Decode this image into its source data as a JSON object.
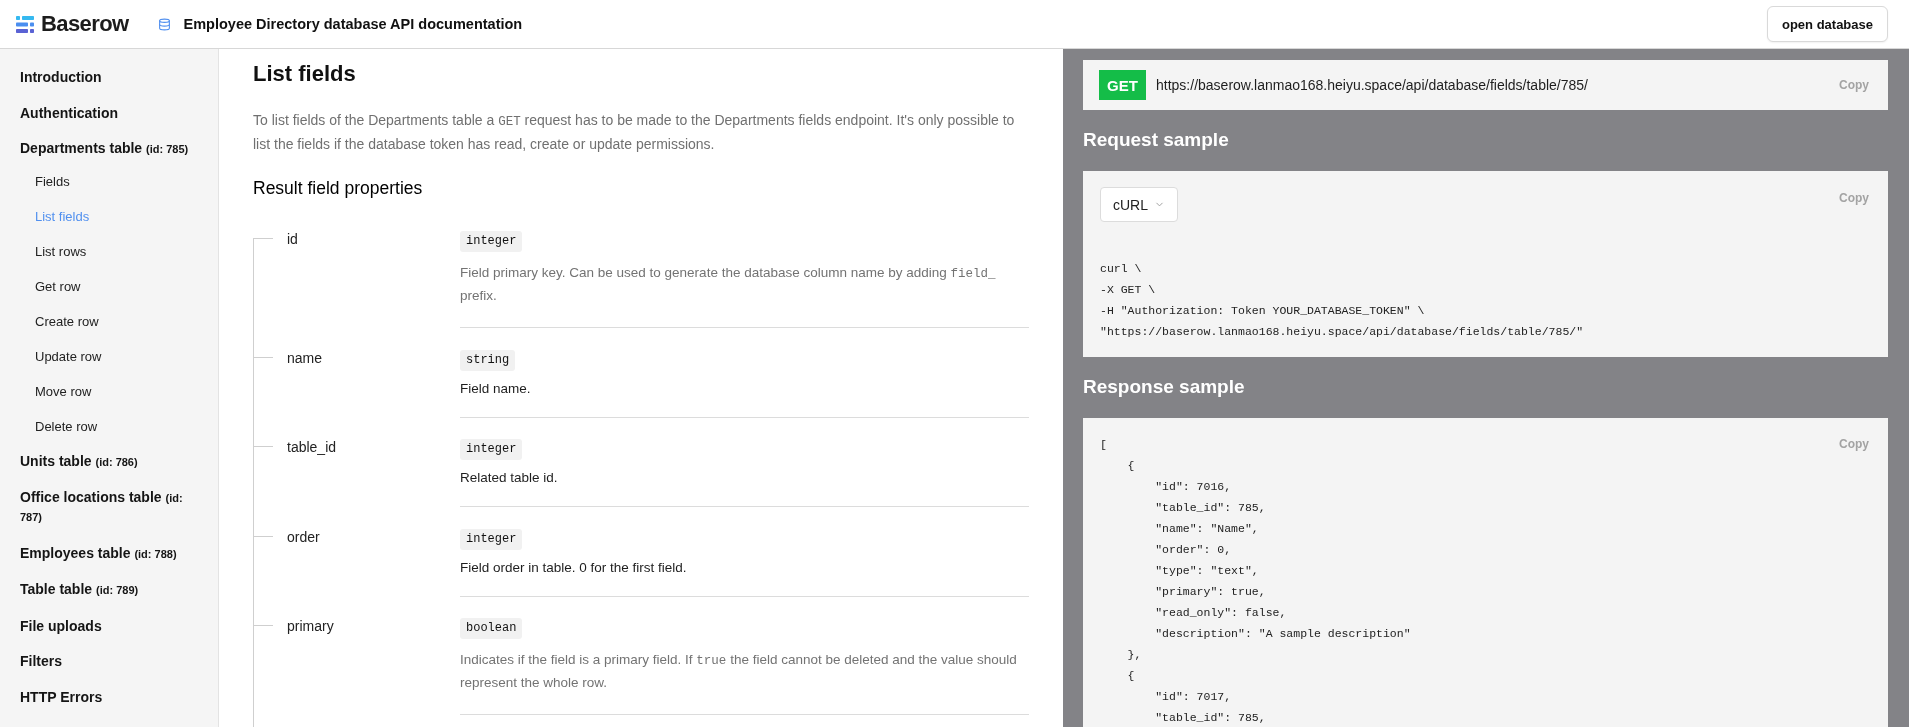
{
  "header": {
    "logo": "Baserow",
    "title": "Employee Directory database API documentation",
    "open_button": "open database"
  },
  "sidebar": {
    "items": [
      {
        "label": "Introduction",
        "selected": false
      },
      {
        "label": "Authentication",
        "selected": false
      },
      {
        "label": "Departments table",
        "note": "(id: 785)",
        "selected": false,
        "children": [
          {
            "label": "Fields",
            "selected": false
          },
          {
            "label": "List fields",
            "selected": true
          },
          {
            "label": "List rows",
            "selected": false
          },
          {
            "label": "Get row",
            "selected": false
          },
          {
            "label": "Create row",
            "selected": false
          },
          {
            "label": "Update row",
            "selected": false
          },
          {
            "label": "Move row",
            "selected": false
          },
          {
            "label": "Delete row",
            "selected": false
          }
        ]
      },
      {
        "label": "Units table",
        "note": "(id: 786)",
        "selected": false
      },
      {
        "label": "Office locations table",
        "note": "(id: 787)",
        "selected": false
      },
      {
        "label": "Employees table",
        "note": "(id: 788)",
        "selected": false
      },
      {
        "label": "Table table",
        "note": "(id: 789)",
        "selected": false
      },
      {
        "label": "File uploads",
        "selected": false
      },
      {
        "label": "Filters",
        "selected": false
      },
      {
        "label": "HTTP Errors",
        "selected": false
      }
    ]
  },
  "content": {
    "title": "List fields",
    "description": [
      {
        "text": "To list fields of the Departments table a ",
        "code": false
      },
      {
        "text": "GET",
        "code": true
      },
      {
        "text": " request has to be made to the Departments fields endpoint. It's only possible to list the fields if the database token has read, create or update permissions.",
        "code": false
      }
    ],
    "properties_heading": "Result field properties",
    "properties": [
      {
        "name": "id",
        "type": "integer",
        "muted": true,
        "description": [
          {
            "text": "Field primary key. Can be used to generate the database column name by adding ",
            "code": false
          },
          {
            "text": "field_",
            "code": true
          },
          {
            "text": " prefix.",
            "code": false
          }
        ]
      },
      {
        "name": "name",
        "type": "string",
        "muted": false,
        "description": [
          {
            "text": "Field name.",
            "code": false
          }
        ]
      },
      {
        "name": "table_id",
        "type": "integer",
        "muted": false,
        "description": [
          {
            "text": "Related table id.",
            "code": false
          }
        ]
      },
      {
        "name": "order",
        "type": "integer",
        "muted": false,
        "description": [
          {
            "text": "Field order in table. 0 for the first field.",
            "code": false
          }
        ]
      },
      {
        "name": "primary",
        "type": "boolean",
        "muted": true,
        "description": [
          {
            "text": "Indicates if the field is a primary field. If ",
            "code": false
          },
          {
            "text": "true",
            "code": true
          },
          {
            "text": " the field cannot be deleted and the value should represent the whole row.",
            "code": false
          }
        ]
      }
    ]
  },
  "endpoint": {
    "method": "GET",
    "url": "https://baserow.lanmao168.heiyu.space/api/database/fields/table/785/",
    "copy": "Copy"
  },
  "request_sample": {
    "heading": "Request sample",
    "language": "cURL",
    "copy": "Copy",
    "code": [
      "curl \\",
      "-X GET \\",
      "-H \"Authorization: Token YOUR_DATABASE_TOKEN\" \\",
      "\"https://baserow.lanmao168.heiyu.space/api/database/fields/table/785/\""
    ]
  },
  "response_sample": {
    "heading": "Response sample",
    "copy": "Copy",
    "code": [
      "[",
      "    {",
      "        \"id\": 7016,",
      "        \"table_id\": 785,",
      "        \"name\": \"Name\",",
      "        \"order\": 0,",
      "        \"type\": \"text\",",
      "        \"primary\": true,",
      "        \"read_only\": false,",
      "        \"description\": \"A sample description\"",
      "    },",
      "    {",
      "        \"id\": 7017,",
      "        \"table_id\": 785,"
    ]
  }
}
